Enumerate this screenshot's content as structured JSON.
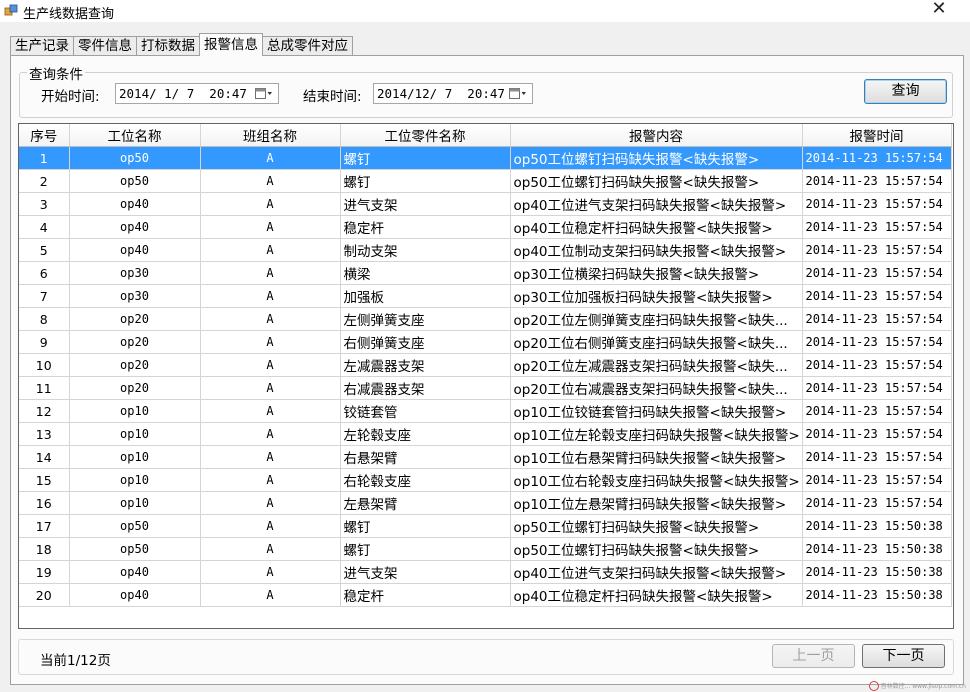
{
  "window": {
    "title": "生产线数据查询",
    "close_glyph": "✕"
  },
  "tabs": [
    "生产记录",
    "零件信息",
    "打标数据",
    "报警信息",
    "总成零件对应"
  ],
  "active_tab_index": 3,
  "query": {
    "group_title": "查询条件",
    "start_label": "开始时间:",
    "start_value": "2014/ 1/ 7  20:47",
    "end_label": "结束时间:",
    "end_value": "2014/12/ 7  20:47",
    "search_button": "查询"
  },
  "table": {
    "columns": [
      "序号",
      "工位名称",
      "班组名称",
      "工位零件名称",
      "报警内容",
      "报警时间"
    ],
    "selected_row_index": 0,
    "rows": [
      [
        "1",
        "op50",
        "A",
        "螺钉",
        "op50工位螺钉扫码缺失报警<缺失报警>",
        "2014-11-23 15:57:54"
      ],
      [
        "2",
        "op50",
        "A",
        "螺钉",
        "op50工位螺钉扫码缺失报警<缺失报警>",
        "2014-11-23 15:57:54"
      ],
      [
        "3",
        "op40",
        "A",
        "进气支架",
        "op40工位进气支架扫码缺失报警<缺失报警>",
        "2014-11-23 15:57:54"
      ],
      [
        "4",
        "op40",
        "A",
        "稳定杆",
        "op40工位稳定杆扫码缺失报警<缺失报警>",
        "2014-11-23 15:57:54"
      ],
      [
        "5",
        "op40",
        "A",
        "制动支架",
        "op40工位制动支架扫码缺失报警<缺失报警>",
        "2014-11-23 15:57:54"
      ],
      [
        "6",
        "op30",
        "A",
        "横梁",
        "op30工位横梁扫码缺失报警<缺失报警>",
        "2014-11-23 15:57:54"
      ],
      [
        "7",
        "op30",
        "A",
        "加强板",
        "op30工位加强板扫码缺失报警<缺失报警>",
        "2014-11-23 15:57:54"
      ],
      [
        "8",
        "op20",
        "A",
        "左侧弹簧支座",
        "op20工位左侧弹簧支座扫码缺失报警<缺失...",
        "2014-11-23 15:57:54"
      ],
      [
        "9",
        "op20",
        "A",
        "右侧弹簧支座",
        "op20工位右侧弹簧支座扫码缺失报警<缺失...",
        "2014-11-23 15:57:54"
      ],
      [
        "10",
        "op20",
        "A",
        "左减震器支架",
        "op20工位左减震器支架扫码缺失报警<缺失...",
        "2014-11-23 15:57:54"
      ],
      [
        "11",
        "op20",
        "A",
        "右减震器支架",
        "op20工位右减震器支架扫码缺失报警<缺失...",
        "2014-11-23 15:57:54"
      ],
      [
        "12",
        "op10",
        "A",
        "铰链套管",
        "op10工位铰链套管扫码缺失报警<缺失报警>",
        "2014-11-23 15:57:54"
      ],
      [
        "13",
        "op10",
        "A",
        "左轮毂支座",
        "op10工位左轮毂支座扫码缺失报警<缺失报警>",
        "2014-11-23 15:57:54"
      ],
      [
        "14",
        "op10",
        "A",
        "右悬架臂",
        "op10工位右悬架臂扫码缺失报警<缺失报警>",
        "2014-11-23 15:57:54"
      ],
      [
        "15",
        "op10",
        "A",
        "右轮毂支座",
        "op10工位右轮毂支座扫码缺失报警<缺失报警>",
        "2014-11-23 15:57:54"
      ],
      [
        "16",
        "op10",
        "A",
        "左悬架臂",
        "op10工位左悬架臂扫码缺失报警<缺失报警>",
        "2014-11-23 15:57:54"
      ],
      [
        "17",
        "op50",
        "A",
        "螺钉",
        "op50工位螺钉扫码缺失报警<缺失报警>",
        "2014-11-23 15:50:38"
      ],
      [
        "18",
        "op50",
        "A",
        "螺钉",
        "op50工位螺钉扫码缺失报警<缺失报警>",
        "2014-11-23 15:50:38"
      ],
      [
        "19",
        "op40",
        "A",
        "进气支架",
        "op40工位进气支架扫码缺失报警<缺失报警>",
        "2014-11-23 15:50:38"
      ],
      [
        "20",
        "op40",
        "A",
        "稳定杆",
        "op40工位稳定杆扫码缺失报警<缺失报警>",
        "2014-11-23 15:50:38"
      ]
    ]
  },
  "footer": {
    "page_info": "当前1/12页",
    "prev_button": "上一页",
    "next_button": "下一页",
    "prev_disabled": true,
    "watermark": "吉林数控...  www.jlsop.com.cn"
  },
  "colors": {
    "selection": "#3399ff",
    "window_bg": "#f0f0f0"
  }
}
